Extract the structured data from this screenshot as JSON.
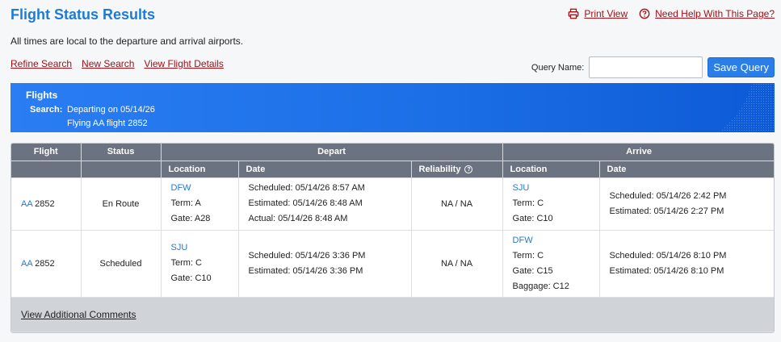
{
  "header": {
    "title": "Flight Status Results",
    "print_label": "Print View",
    "help_label": "Need Help With This Page?"
  },
  "subtitle": "All times are local to the departure and arrival airports.",
  "actions": {
    "refine": "Refine Search",
    "new": "New Search",
    "details": "View Flight Details"
  },
  "query": {
    "label": "Query Name:",
    "value": "",
    "save_label": "Save Query"
  },
  "banner": {
    "title": "Flights",
    "search_label": "Search:",
    "line1": "Departing on 05/14/26",
    "line2": "Flying AA flight 2852"
  },
  "table": {
    "headers": {
      "flight": "Flight",
      "status": "Status",
      "depart": "Depart",
      "arrive": "Arrive",
      "location": "Location",
      "date": "Date",
      "reliability": "Reliability",
      "help_glyph": "?"
    },
    "rows": [
      {
        "airline": "AA",
        "number": "2852",
        "status": "En Route",
        "dep_code": "DFW",
        "dep_term": "Term: A",
        "dep_gate": "Gate: A28",
        "dep_scheduled": "Scheduled: 05/14/26 8:57 AM",
        "dep_estimated": "Estimated:  05/14/26 8:48 AM",
        "dep_actual": "Actual:  05/14/26 8:48 AM",
        "reliability": "NA / NA",
        "arr_code": "SJU",
        "arr_term": "Term: C",
        "arr_gate": "Gate: C10",
        "arr_scheduled": "Scheduled: 05/14/26 2:42 PM",
        "arr_estimated": "Estimated:  05/14/26 2:27 PM"
      },
      {
        "airline": "AA",
        "number": "2852",
        "status": "Scheduled",
        "dep_code": "SJU",
        "dep_term": "Term: C",
        "dep_gate": "Gate: C10",
        "dep_scheduled": "Scheduled: 05/14/26 3:36 PM",
        "dep_estimated": "Estimated:  05/14/26 3:36 PM",
        "reliability": "NA / NA",
        "arr_code": "DFW",
        "arr_term": "Term: C",
        "arr_gate": "Gate: C15",
        "arr_baggage": "Baggage: C12",
        "arr_scheduled": "Scheduled: 05/14/26 8:10 PM",
        "arr_estimated": "Estimated:  05/14/26 8:10 PM"
      }
    ],
    "footer_link": "View Additional Comments"
  },
  "colors": {
    "brand_blue": "#1f7ad6",
    "link_red": "#a40f16",
    "header_gray": "#6b7280"
  }
}
